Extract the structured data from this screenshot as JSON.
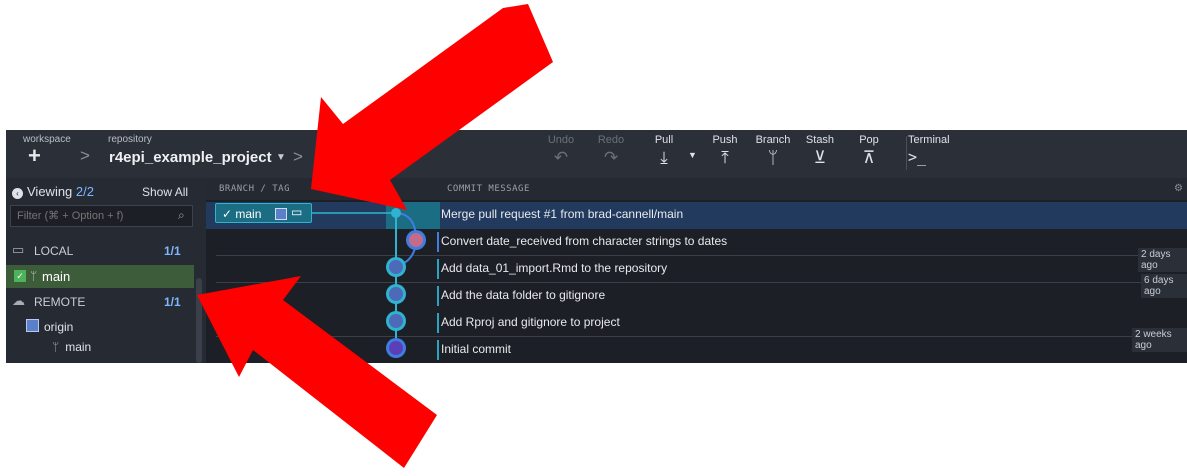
{
  "toolbar": {
    "workspace_label": "workspace",
    "repository_label": "repository",
    "plus_icon": "+",
    "repo_name": "r4epi_example_project",
    "actions": [
      {
        "label": "Undo",
        "icon": "↶",
        "enabled": false
      },
      {
        "label": "Redo",
        "icon": "↷",
        "enabled": false
      },
      {
        "label": "Pull",
        "icon": "⤓",
        "enabled": true
      },
      {
        "label": "Push",
        "icon": "⤒",
        "enabled": true
      },
      {
        "label": "Branch",
        "icon": "ᛘ",
        "enabled": true
      },
      {
        "label": "Stash",
        "icon": "⊻",
        "enabled": true
      },
      {
        "label": "Pop",
        "icon": "⊼",
        "enabled": true
      },
      {
        "label": "Terminal",
        "icon": ">_",
        "enabled": true
      }
    ]
  },
  "sidebar": {
    "viewing_label": "Viewing",
    "viewing_count": "2/2",
    "show_all": "Show All",
    "filter_placeholder": "Filter (⌘ + Option + f)",
    "local": {
      "label": "LOCAL",
      "count": "1/1"
    },
    "local_branch": "main",
    "remote": {
      "label": "REMOTE",
      "count": "1/1"
    },
    "origin": "origin",
    "remote_branch": "main"
  },
  "columns": {
    "branch_tag": "BRANCH / TAG",
    "graph": "PH",
    "commit_message": "COMMIT MESSAGE"
  },
  "branch_tag": {
    "label": "main"
  },
  "commits": [
    {
      "message": "Merge pull request #1 from brad-cannell/main"
    },
    {
      "message": "Convert date_received from character strings to dates"
    },
    {
      "message": "Add data_01_import.Rmd to the repository"
    },
    {
      "message": "Add the data folder to gitignore"
    },
    {
      "message": "Add Rproj and gitignore to project"
    },
    {
      "message": "Initial commit"
    }
  ],
  "times": [
    "2 days ago",
    "6 days ago",
    "2 weeks ago"
  ],
  "colors": {
    "arrow": "#ff0000",
    "accent": "#2fb3d1",
    "local_row": "#3d5c3a"
  }
}
